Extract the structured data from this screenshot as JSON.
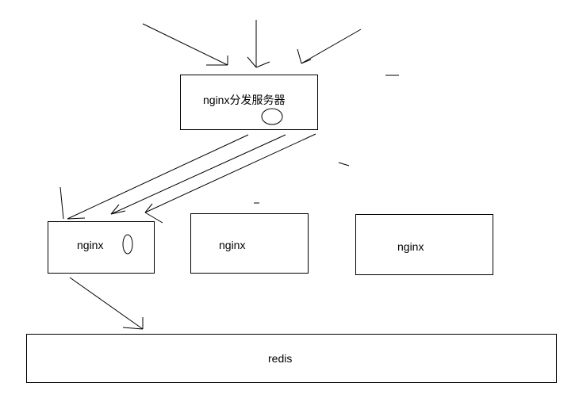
{
  "diagram": {
    "dispatcher": {
      "label": "nginx分发服务器"
    },
    "nodes": [
      {
        "label": "nginx"
      },
      {
        "label": "nginx"
      },
      {
        "label": "nginx"
      }
    ],
    "store": {
      "label": "redis"
    }
  }
}
